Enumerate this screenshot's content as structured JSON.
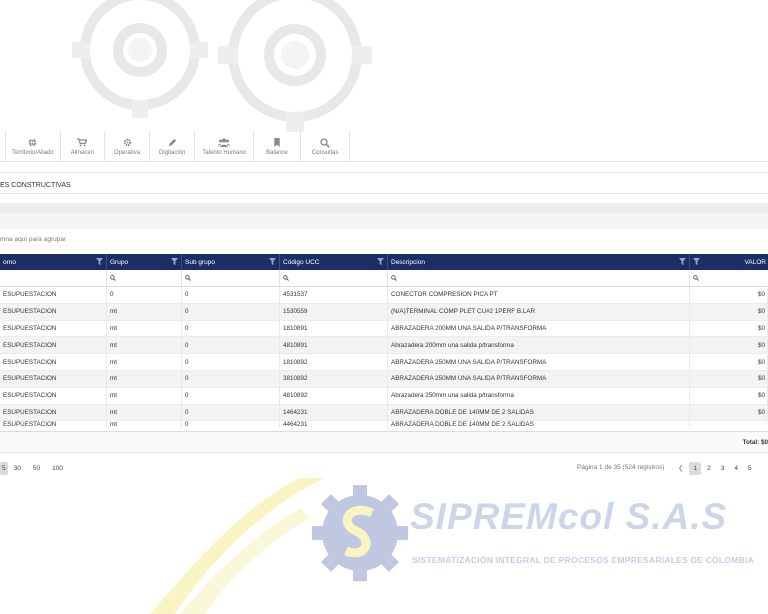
{
  "toolbar": {
    "items": [
      {
        "label": "Territorio/Aliado",
        "icon": "globe-icon"
      },
      {
        "label": "Almacen",
        "icon": "cart-icon"
      },
      {
        "label": "Operativa",
        "icon": "gear-icon"
      },
      {
        "label": "Digitacion",
        "icon": "pencil-icon"
      },
      {
        "label": "Talento Humano",
        "icon": "users-icon"
      },
      {
        "label": "Balance",
        "icon": "bookmark-icon"
      },
      {
        "label": "Consultas",
        "icon": "search-icon"
      }
    ]
  },
  "section": {
    "title": "ES CONSTRUCTIVAS"
  },
  "grid": {
    "group_hint": "mna aquí para agrupar",
    "headers": [
      "orno",
      "Grupo",
      "Sub grupo",
      "Código UCC",
      "Descripcion",
      "VALOR"
    ],
    "rows": [
      [
        "ESUPUESTACION",
        "0",
        "0",
        "4531537",
        "CONECTOR COMPRESION PICA PT",
        "$0"
      ],
      [
        "ESUPUESTACION",
        "mt",
        "0",
        "1530559",
        "(N/A)TERMINAL COMP PLET CU#2 1PERF B.LAR",
        "$0"
      ],
      [
        "ESUPUESTACION",
        "mt",
        "0",
        "1810891",
        "ABRAZADERA 200MM UNA SALIDA P/TRANSFORMA",
        "$0"
      ],
      [
        "ESUPUESTACION",
        "mt",
        "0",
        "4810891",
        "Abrazadera 200mm una salida p/transforma",
        "$0"
      ],
      [
        "ESUPUESTACION",
        "mt",
        "0",
        "1810892",
        "ABRAZADERA 250MM UNA SALIDA P/TRANSFORMA",
        "$0"
      ],
      [
        "ESUPUESTACION",
        "mt",
        "0",
        "3810892",
        "ABRAZADERA 250MM UNA SALIDA P/TRANSFORMA",
        "$0"
      ],
      [
        "ESUPUESTACION",
        "mt",
        "0",
        "4810892",
        "Abrazadera 250mm una salida p/transforma",
        "$0"
      ],
      [
        "ESUPUESTACION",
        "mt",
        "0",
        "1464231",
        "ABRAZADERA DOBLE DE 140MM DE 2 SALIDAS",
        "$0"
      ],
      [
        "ESUPUESTACION",
        "mt",
        "0",
        "4464231",
        "ABRAZADERA DOBLE DE 140MM DE 2 SALIDAS",
        ""
      ]
    ],
    "total": "Total: $0"
  },
  "pager": {
    "sizes": [
      "5",
      "30",
      "50",
      "100"
    ],
    "info": "Página 1 de 35 (524 registros)",
    "prev": "❮",
    "pages": [
      "1",
      "2",
      "3",
      "4",
      "5"
    ]
  },
  "watermark": {
    "title": "SIPREMcol S.A.S",
    "subtitle": "SISTEMATIZACIÓN INTEGRAL DE PROCESOS EMPRESARIALES DE COLOMBIA"
  },
  "colors": {
    "header_bg": "#1b2f66",
    "accent_yellow": "#f2e25a"
  }
}
